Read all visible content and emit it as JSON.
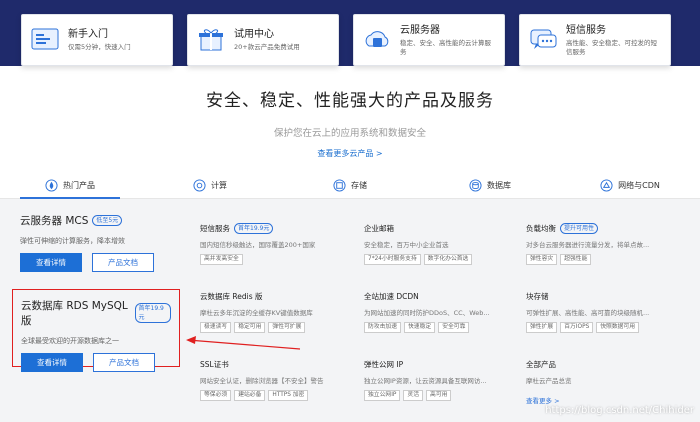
{
  "top_cards": [
    {
      "title": "新手入门",
      "desc": "仅需5分钟，快速入门",
      "icon": "guide-icon"
    },
    {
      "title": "试用中心",
      "desc": "20+款云产品免费试用",
      "icon": "gift-icon"
    },
    {
      "title": "云服务器",
      "desc": "稳定、安全、高性能的云计算服务",
      "icon": "cloud-server-icon"
    },
    {
      "title": "短信服务",
      "desc": "高性能、安全稳定、可控发的短信服务",
      "icon": "sms-icon"
    }
  ],
  "hero": {
    "title": "安全、稳定、性能强大的产品及服务",
    "subtitle": "保护您在云上的应用系统和数据安全",
    "more_link": "查看更多云产品 >"
  },
  "tabs": [
    {
      "label": "热门产品",
      "icon": "fire-icon"
    },
    {
      "label": "计算",
      "icon": "compute-icon"
    },
    {
      "label": "存储",
      "icon": "storage-icon"
    },
    {
      "label": "数据库",
      "icon": "database-icon"
    },
    {
      "label": "网络与CDN",
      "icon": "network-icon"
    }
  ],
  "featured": [
    {
      "name": "云服务器 MCS",
      "badge": "低至5元",
      "desc": "弹性可伸缩的计算服务，降本增效",
      "primary": "查看详情",
      "secondary": "产品文档"
    },
    {
      "name": "云数据库 RDS MySQL 版",
      "badge": "首年19.9元",
      "desc": "全球最受欢迎的开源数据库之一",
      "primary": "查看详情",
      "secondary": "产品文档"
    }
  ],
  "products": [
    {
      "name": "短信服务",
      "badge": "首年19.9元",
      "desc": "国内短信秒级触达，国际覆盖200+国家",
      "tags": [
        "高并发高安全"
      ]
    },
    {
      "name": "企业邮箱",
      "badge": "",
      "desc": "安全稳定，百万中小企业首选",
      "tags": [
        "7*24小时服务支持",
        "数字化办公首选"
      ]
    },
    {
      "name": "负载均衡",
      "badge": "提升可用性",
      "desc": "对多台云服务器进行流量分发，将单点故...",
      "tags": [
        "弹性容灾",
        "超强性能"
      ]
    },
    {
      "name": "云数据库 Redis 版",
      "badge": "",
      "desc": "摩杜云多年沉淀的全缓存KV键值数据库",
      "tags": [
        "极速读写",
        "稳定可用",
        "弹性可扩展"
      ]
    },
    {
      "name": "全站加速 DCDN",
      "badge": "",
      "desc": "为网站加速的同时防护DDoS、CC、Web...",
      "tags": [
        "防攻击加速",
        "快速稳定",
        "安全可靠"
      ]
    },
    {
      "name": "块存储",
      "badge": "",
      "desc": "可弹性扩展、高性能、高可靠的块级随机...",
      "tags": [
        "弹性扩展",
        "百万IOPS",
        "快照数据可用"
      ]
    },
    {
      "name": "SSL证书",
      "badge": "",
      "desc": "网站安全认证，删除浏览器【不安全】警告",
      "tags": [
        "等保必须",
        "建站必备",
        "HTTPS 加密"
      ]
    },
    {
      "name": "弹性公网 IP",
      "badge": "",
      "desc": "独立公网IP资源，让云资源具备互联网访...",
      "tags": [
        "独立公网IP",
        "灵活",
        "高可用"
      ]
    },
    {
      "name": "全部产品",
      "badge": "",
      "desc": "摩杜云产品总览",
      "tags": [],
      "link": "查看更多 >"
    }
  ],
  "watermark": "https://blog.csdn.net/Chihider",
  "colors": {
    "brand": "#1d6fd6",
    "highlight": "#e02020",
    "band": "#1f2a6b"
  }
}
